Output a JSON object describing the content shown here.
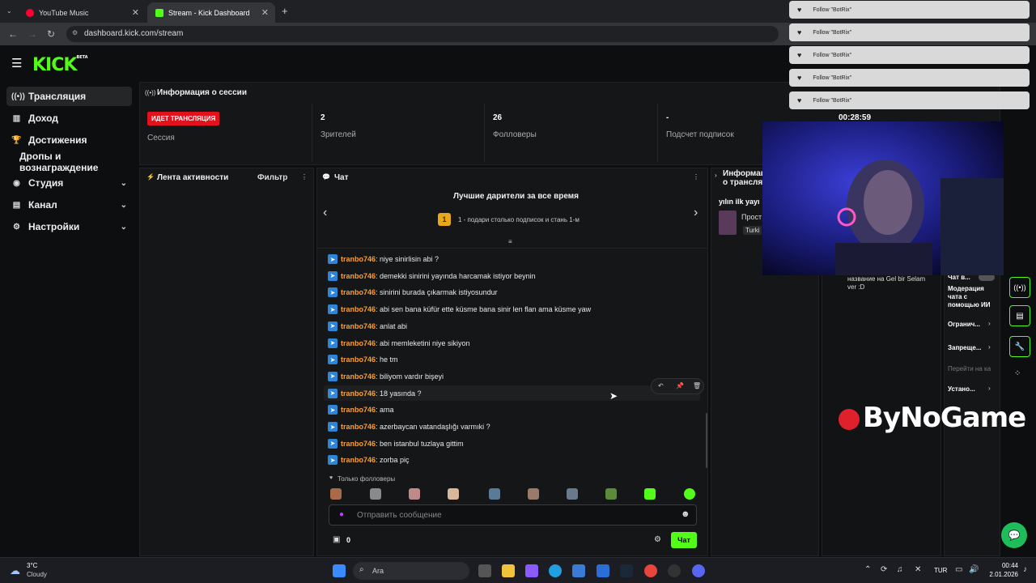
{
  "browser": {
    "tabs": [
      {
        "label": "YouTube Music",
        "favicon_color": "#ff0033"
      },
      {
        "label": "Stream - Kick Dashboard",
        "favicon_color": "#53fc18"
      }
    ],
    "url": "dashboard.kick.com/stream"
  },
  "app": {
    "logo": "KICK",
    "logo_badge": "BETA",
    "accent_color": "#53fc18"
  },
  "sidebar": {
    "items": [
      {
        "label": "Трансляция",
        "icon": "broadcast-icon"
      },
      {
        "label": "Доход",
        "icon": "revenue-icon"
      },
      {
        "label": "Достижения",
        "icon": "trophy-icon"
      },
      {
        "label": "Дропы и вознаграждение",
        "icon": ""
      },
      {
        "label": "Студия",
        "icon": "studio-icon"
      },
      {
        "label": "Канал",
        "icon": "channel-icon"
      },
      {
        "label": "Настройки",
        "icon": "settings-icon"
      }
    ]
  },
  "session": {
    "title": "Информация о сессии",
    "live_badge": "ИДЕТ ТРАНСЛЯЦИЯ",
    "session_label": "Сессия",
    "viewers_value": "2",
    "viewers_label": "Зрителей",
    "followers_value": "26",
    "followers_label": "Фолловеры",
    "subs_value": "-",
    "subs_label": "Подсчет подписок",
    "timer": "00:28:59"
  },
  "activity": {
    "title": "Лента активности",
    "filter": "Фильтр"
  },
  "chat": {
    "title": "Чат",
    "gifters_title": "Лучшие дарители за все время",
    "gifters_rank": "1",
    "gifters_text": "1 - подари столько подписок и стань 1-м",
    "messages": [
      {
        "user": "tranbo746",
        "text": ": niye sinirlisin abi ?"
      },
      {
        "user": "tranbo746",
        "text": ": demekki sinirini yayında harcamak istiyor beynin"
      },
      {
        "user": "tranbo746",
        "text": ": sinirini burada çıkarmak istiyosundur"
      },
      {
        "user": "tranbo746",
        "text": ": abi sen bana küfür ette küsme bana sinir len flan ama küsme yaw"
      },
      {
        "user": "tranbo746",
        "text": ": anlat abi"
      },
      {
        "user": "tranbo746",
        "text": ": abi memleketini niye sikiyon"
      },
      {
        "user": "tranbo746",
        "text": ": he tm"
      },
      {
        "user": "tranbo746",
        "text": ": biliyom vardır bişeyi"
      },
      {
        "user": "tranbo746",
        "text": ": 18 yasında ?"
      },
      {
        "user": "tranbo746",
        "text": ": ama"
      },
      {
        "user": "tranbo746",
        "text": ": azerbaycan vatandaşlığı varmıki ?"
      },
      {
        "user": "tranbo746",
        "text": ": ben istanbul tuzlaya gittim"
      },
      {
        "user": "tranbo746",
        "text": ": zorba piç"
      }
    ],
    "followers_only": "Только фолловеры",
    "input_placeholder": "Отправить сообщение",
    "points": "0",
    "send_label": "Чат"
  },
  "stream_info": {
    "title": "Информац о трансля",
    "stream_title": "yılın ilk yayı",
    "category_label": "Прост",
    "tag": "Turki",
    "title_change": "название на Gel bir Selam ver :D"
  },
  "moderation": {
    "chat_label": "Чат в...",
    "ai_moderation": "Модерация чата с помощью ИИ",
    "restrictions": "Огранич...",
    "bans": "Запреще...",
    "goto_channel": "Перейти на ка",
    "install": "Устано..."
  },
  "notifications": [
    {
      "text": "Follow \"BotRix\""
    },
    {
      "text": "Follow \"BotRix\""
    },
    {
      "text": "Follow \"BotRix\""
    },
    {
      "text": "Follow \"BotRix\""
    },
    {
      "text": "Follow \"BotRix\""
    }
  ],
  "overlay": {
    "brand": "ByNoGame"
  },
  "taskbar": {
    "weather_temp": "3°C",
    "weather_desc": "Cloudy",
    "search_label": "Ara",
    "language": "TUR",
    "time": "00:44",
    "date": "2.01.2026"
  }
}
